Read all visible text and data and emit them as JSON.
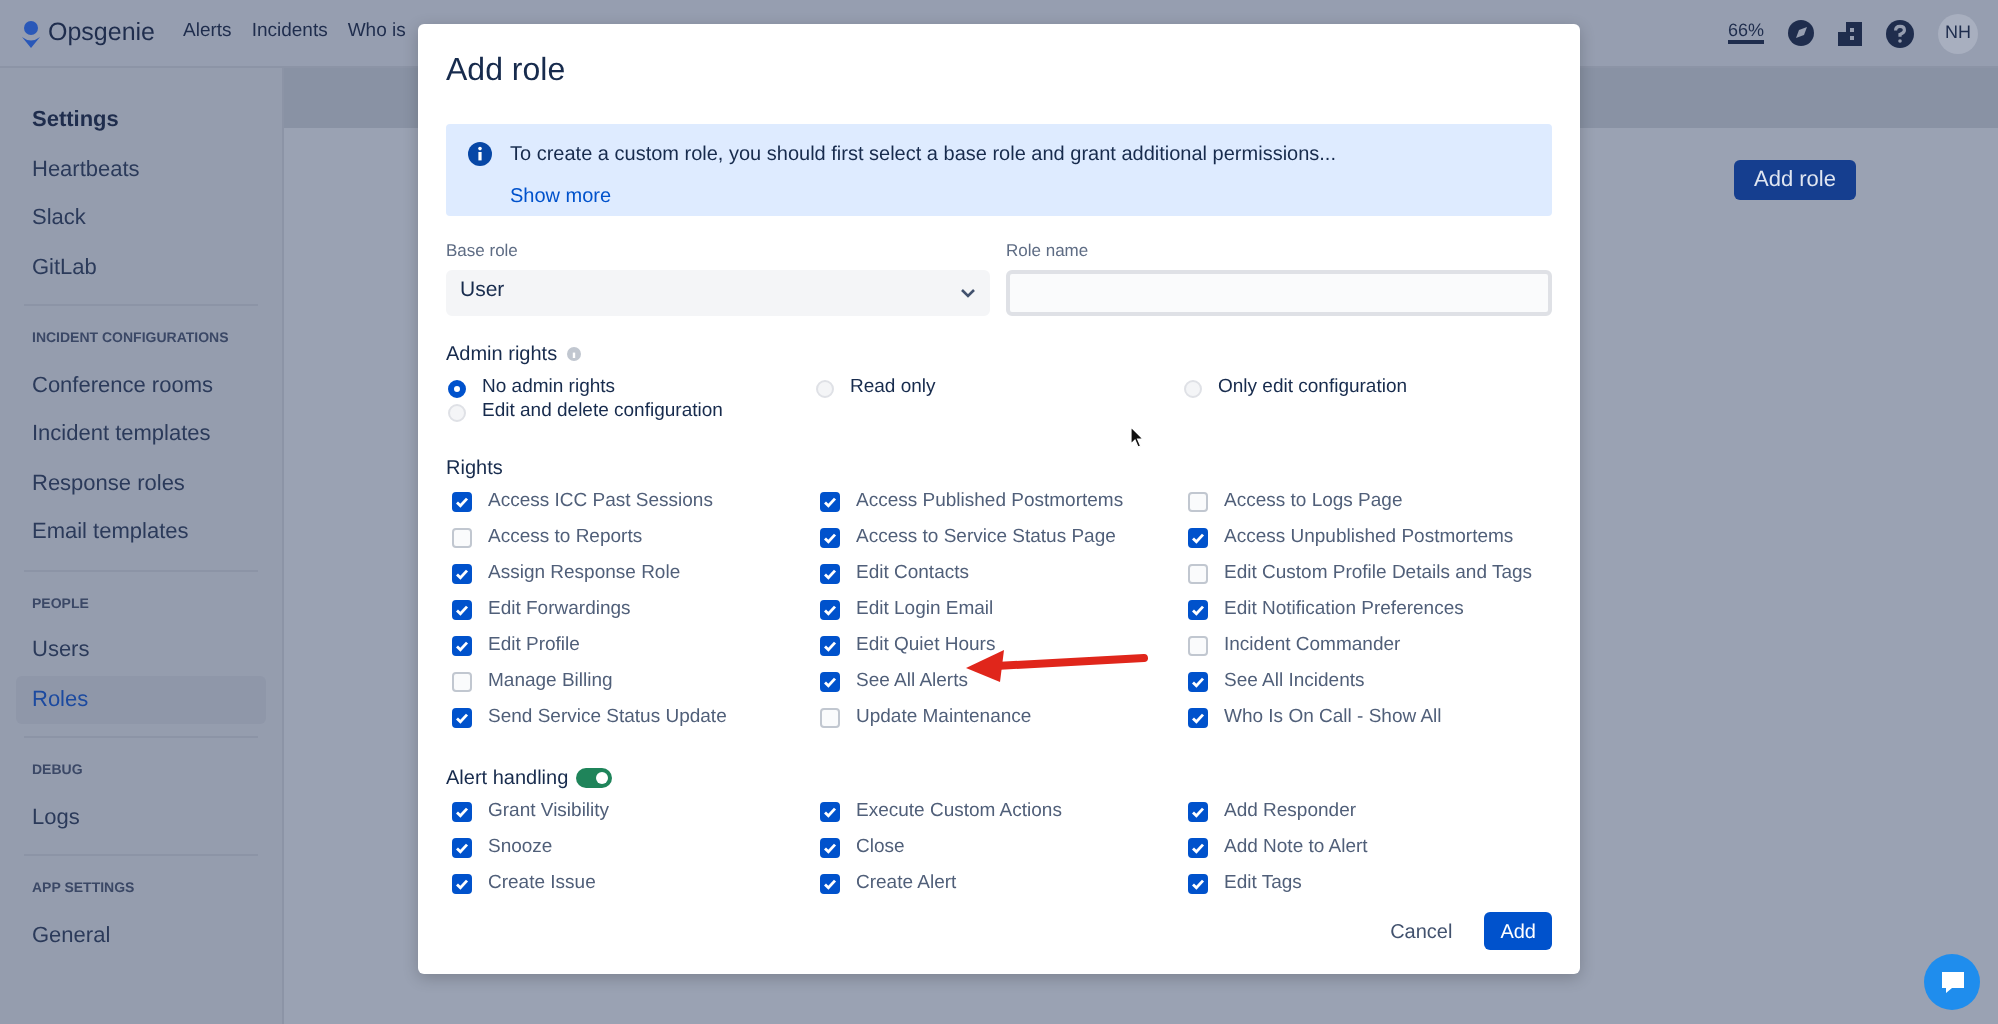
{
  "navbar": {
    "logo": "Opsgenie",
    "links": [
      "Alerts",
      "Incidents",
      "Who is"
    ],
    "zoom": "66%",
    "avatar": "NH"
  },
  "sidebar": {
    "title": "Settings",
    "items": [
      {
        "label": "Heartbeats",
        "selected": false
      },
      {
        "label": "Slack",
        "selected": false
      },
      {
        "label": "GitLab",
        "selected": false
      }
    ],
    "sections": [
      {
        "heading": "INCIDENT CONFIGURATIONS",
        "items": [
          {
            "label": "Conference rooms",
            "selected": false
          },
          {
            "label": "Incident templates",
            "selected": false
          },
          {
            "label": "Response roles",
            "selected": false
          },
          {
            "label": "Email templates",
            "selected": false
          }
        ]
      },
      {
        "heading": "PEOPLE",
        "items": [
          {
            "label": "Users",
            "selected": false
          },
          {
            "label": "Roles",
            "selected": true
          }
        ]
      },
      {
        "heading": "DEBUG",
        "items": [
          {
            "label": "Logs",
            "selected": false
          }
        ]
      },
      {
        "heading": "APP SETTINGS",
        "items": [
          {
            "label": "General",
            "selected": false
          }
        ]
      }
    ]
  },
  "page": {
    "add_role_button": "Add role"
  },
  "modal": {
    "title": "Add role",
    "info": {
      "text": "To create a custom role, you should first select a base role and grant additional permissions...",
      "link": "Show more"
    },
    "base_role": {
      "label": "Base role",
      "value": "User"
    },
    "role_name": {
      "label": "Role name"
    },
    "admin_rights": {
      "label": "Admin rights",
      "options": [
        {
          "label": "No admin rights",
          "selected": true
        },
        {
          "label": "Read only",
          "selected": false
        },
        {
          "label": "Only edit configuration",
          "selected": false
        },
        {
          "label": "Edit and delete configuration",
          "selected": false
        }
      ]
    },
    "rights": {
      "label": "Rights",
      "items": [
        {
          "label": "Access ICC Past Sessions",
          "checked": true
        },
        {
          "label": "Access Published Postmortems",
          "checked": true
        },
        {
          "label": "Access to Logs Page",
          "checked": false
        },
        {
          "label": "Access to Reports",
          "checked": false
        },
        {
          "label": "Access to Service Status Page",
          "checked": true
        },
        {
          "label": "Access Unpublished Postmortems",
          "checked": true
        },
        {
          "label": "Assign Response Role",
          "checked": true
        },
        {
          "label": "Edit Contacts",
          "checked": true
        },
        {
          "label": "Edit Custom Profile Details and Tags",
          "checked": false
        },
        {
          "label": "Edit Forwardings",
          "checked": true
        },
        {
          "label": "Edit Login Email",
          "checked": true
        },
        {
          "label": "Edit Notification Preferences",
          "checked": true
        },
        {
          "label": "Edit Profile",
          "checked": true
        },
        {
          "label": "Edit Quiet Hours",
          "checked": true
        },
        {
          "label": "Incident Commander",
          "checked": false
        },
        {
          "label": "Manage Billing",
          "checked": false
        },
        {
          "label": "See All Alerts",
          "checked": true
        },
        {
          "label": "See All Incidents",
          "checked": true
        },
        {
          "label": "Send Service Status Update",
          "checked": true
        },
        {
          "label": "Update Maintenance",
          "checked": false
        },
        {
          "label": "Who Is On Call - Show All",
          "checked": true
        }
      ]
    },
    "alert_handling": {
      "label": "Alert handling",
      "on": true,
      "items": [
        {
          "label": "Grant Visibility",
          "checked": true
        },
        {
          "label": "Execute Custom Actions",
          "checked": true
        },
        {
          "label": "Add Responder",
          "checked": true
        },
        {
          "label": "Snooze",
          "checked": true
        },
        {
          "label": "Close",
          "checked": true
        },
        {
          "label": "Add Note to Alert",
          "checked": true
        },
        {
          "label": "Create Issue",
          "checked": true
        },
        {
          "label": "Create Alert",
          "checked": true
        },
        {
          "label": "Edit Tags",
          "checked": true
        }
      ]
    },
    "buttons": {
      "cancel": "Cancel",
      "add": "Add"
    }
  }
}
